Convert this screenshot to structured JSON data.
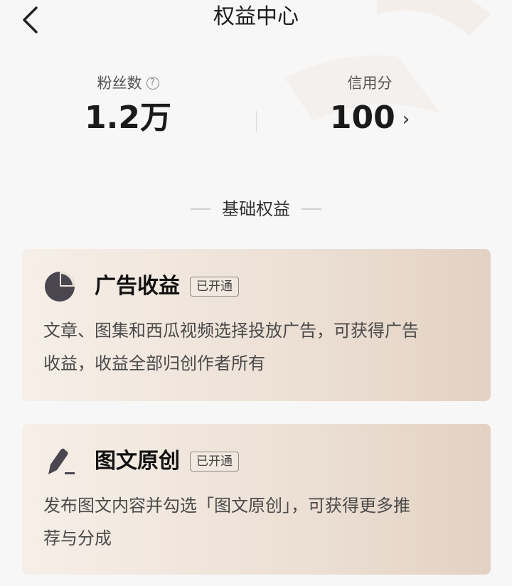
{
  "header": {
    "title": "权益中心"
  },
  "stats": {
    "fans": {
      "label": "粉丝数",
      "value": "1.2万"
    },
    "credit": {
      "label": "信用分",
      "value": "100"
    }
  },
  "section": {
    "title": "基础权益"
  },
  "benefits": [
    {
      "icon": "pie-chart-icon",
      "title": "广告收益",
      "status": "已开通",
      "description": "文章、图集和西瓜视频选择投放广告，可获得广告\n收益，收益全部归创作者所有"
    },
    {
      "icon": "pen-icon",
      "title": "图文原创",
      "status": "已开通",
      "description": "发布图文内容并勾选「图文原创」，可获得更多推\n荐与分成"
    }
  ],
  "colors": {
    "card_gradient_start": "#f6efe8",
    "card_gradient_end": "#e3d2c3",
    "icon_dark": "#4a4650"
  }
}
